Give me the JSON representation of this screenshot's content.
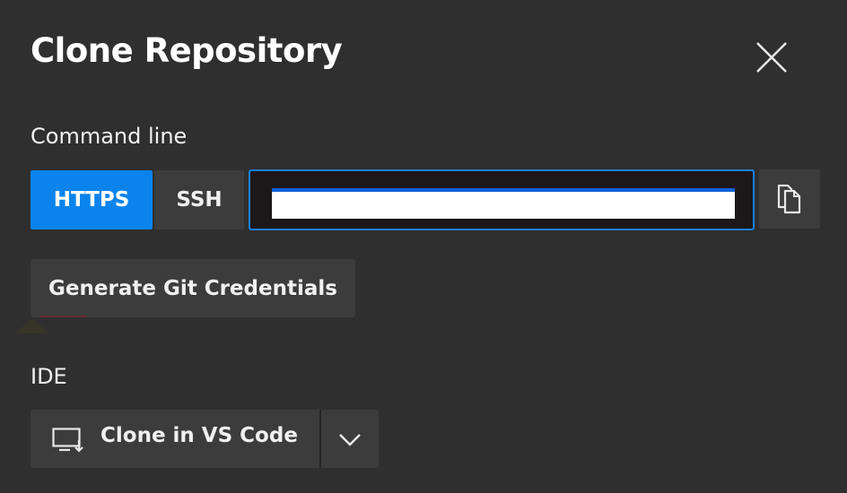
{
  "dialog": {
    "title": "Clone Repository",
    "close_icon": "close-icon"
  },
  "command_line": {
    "label": "Command line",
    "protocols": [
      {
        "label": "HTTPS",
        "selected": true
      },
      {
        "label": "SSH",
        "selected": false
      }
    ],
    "url_value": "",
    "copy_icon": "copy-icon"
  },
  "credentials": {
    "button_label": "Generate Git Credentials"
  },
  "ide": {
    "label": "IDE",
    "clone_button_label": "Clone in VS Code",
    "clone_icon": "monitor-download-icon",
    "dropdown_icon": "chevron-down-icon"
  },
  "colors": {
    "background": "#2f2f2f",
    "accent": "#0a84ec",
    "button": "#3c3c3c",
    "input_border": "#1a7fe8"
  }
}
